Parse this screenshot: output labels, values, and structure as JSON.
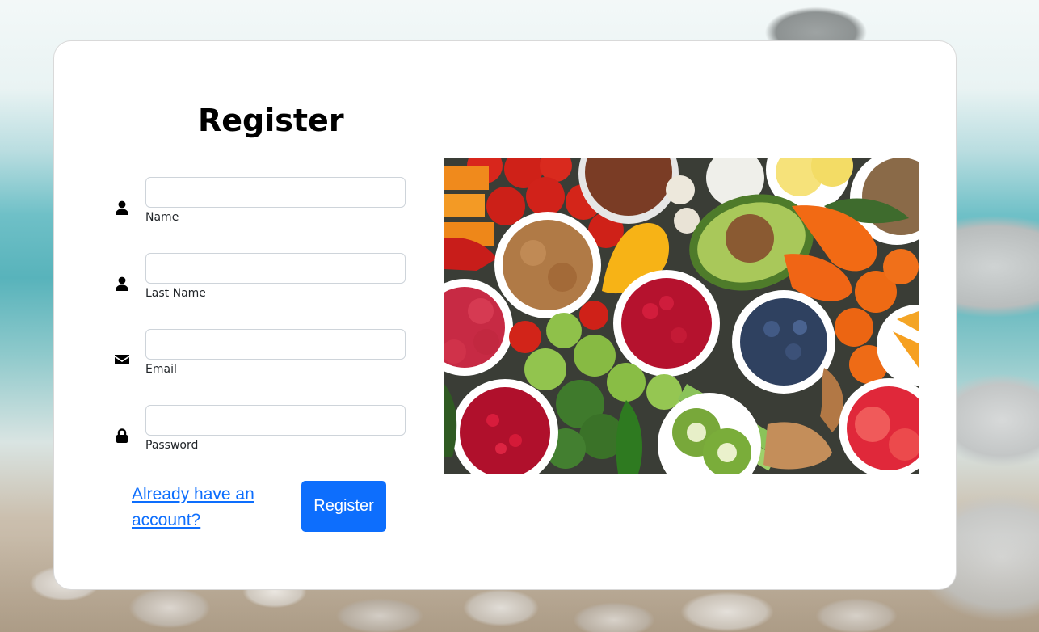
{
  "form": {
    "title": "Register",
    "fields": [
      {
        "label": "Name",
        "value": "",
        "icon": "user-icon",
        "type": "text"
      },
      {
        "label": "Last Name",
        "value": "",
        "icon": "user-icon",
        "type": "text"
      },
      {
        "label": "Email",
        "value": "",
        "icon": "envelope-icon",
        "type": "email"
      },
      {
        "label": "Password",
        "value": "",
        "icon": "lock-icon",
        "type": "password"
      }
    ],
    "login_link": "Already have an account?",
    "submit_label": "Register"
  },
  "image": {
    "subject": "healthy-food-spread"
  },
  "colors": {
    "accent": "#0d6efd",
    "card_background": "#ffffff",
    "text": "#000000"
  }
}
